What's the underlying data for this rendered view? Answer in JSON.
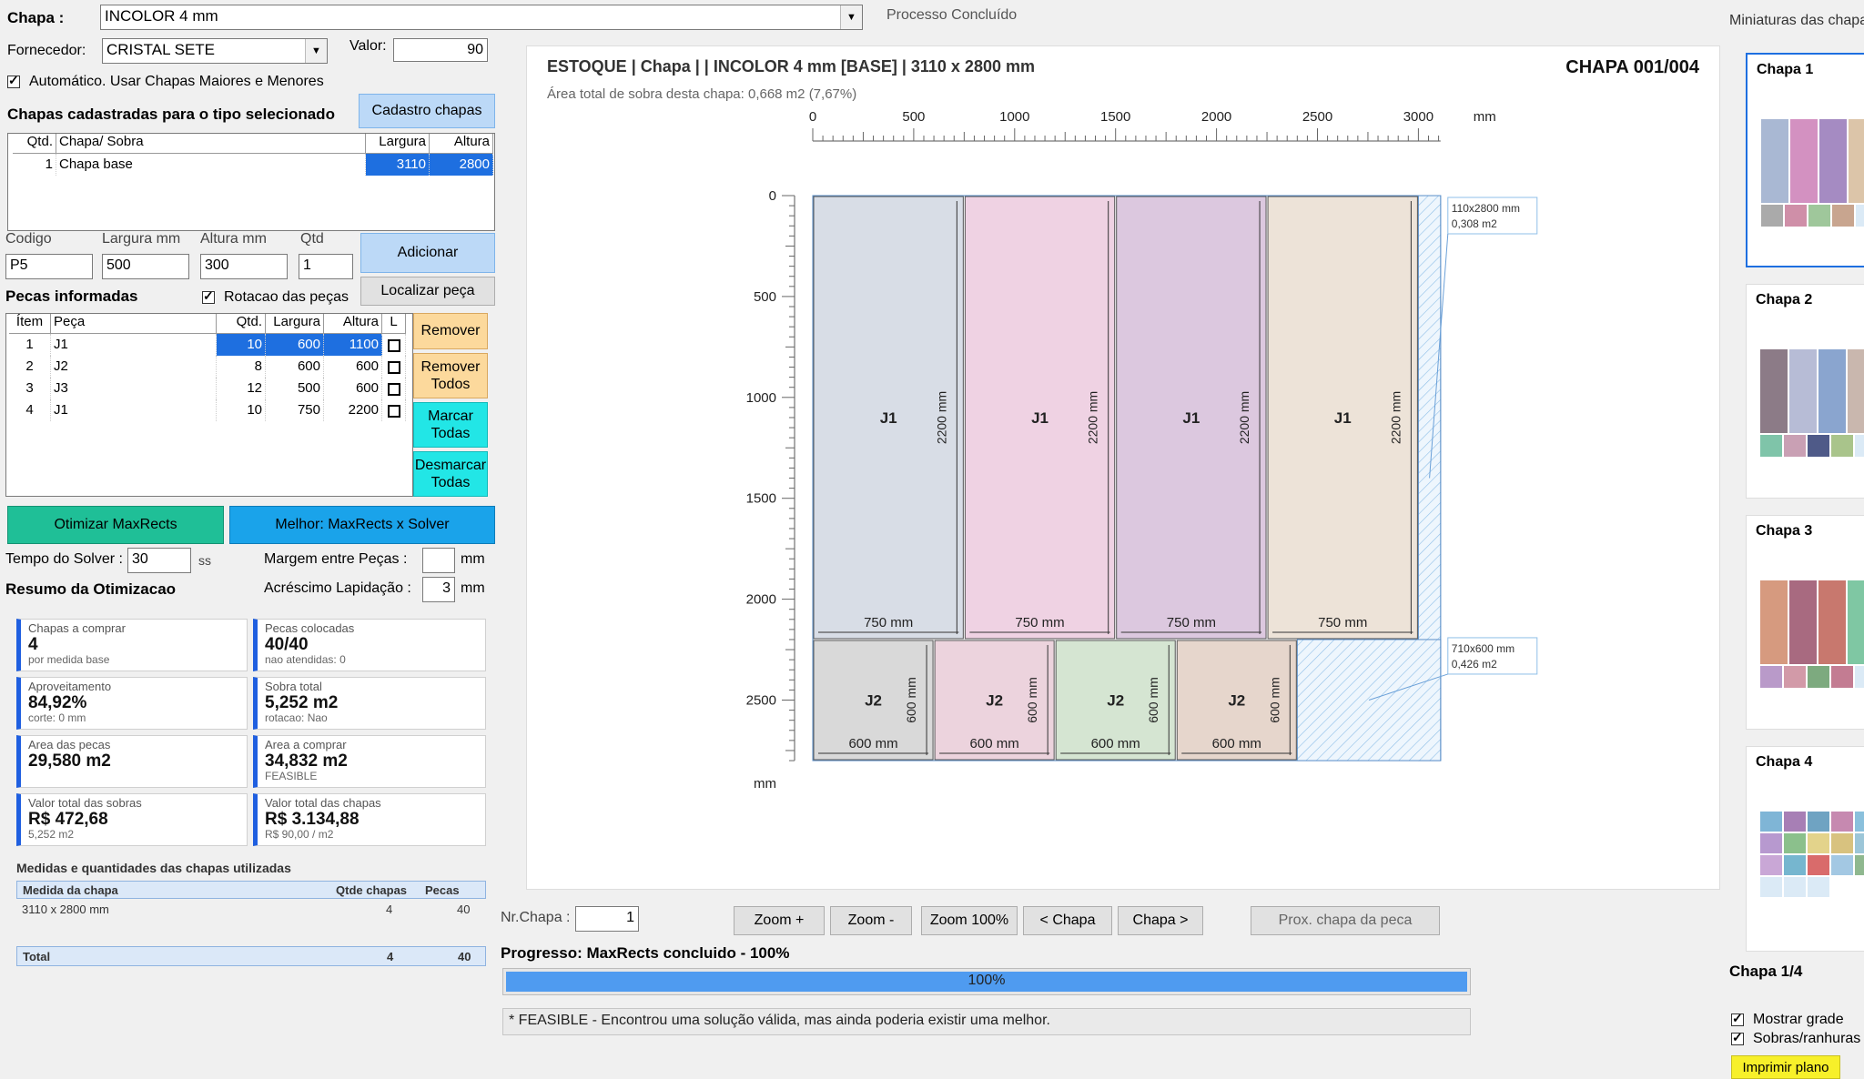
{
  "top": {
    "chapa_label": "Chapa :",
    "chapa_value": "INCOLOR 4 mm",
    "status": "Processo Concluído",
    "fornecedor_label": "Fornecedor:",
    "fornecedor_value": "CRISTAL SETE",
    "valor_label": "Valor:",
    "valor_value": "90",
    "auto_label": "Automático. Usar Chapas Maiores e Menores",
    "section_title": "Chapas cadastradas para o tipo selecionado",
    "cadastro_btn": "Cadastro chapas"
  },
  "chapas_grid": {
    "headers": [
      "Qtd.",
      "Chapa/ Sobra",
      "Largura",
      "Altura"
    ],
    "rows": [
      [
        "1",
        "Chapa base",
        "3110",
        "2800"
      ]
    ]
  },
  "add_form": {
    "codigo_label": "Codigo",
    "largura_label": "Largura mm",
    "altura_label": "Altura mm",
    "qtd_label": "Qtd",
    "codigo_value": "P5",
    "largura_value": "500",
    "altura_value": "300",
    "qtd_value": "1",
    "adicionar_btn": "Adicionar",
    "localizar_btn": "Localizar peça",
    "pecas_title": "Pecas informadas",
    "rotacao_label": "Rotacao das peças"
  },
  "pecas_grid": {
    "headers": [
      "Ítem",
      "Peça",
      "Qtd.",
      "Largura",
      "Altura",
      "L"
    ],
    "rows": [
      [
        "1",
        "J1",
        "10",
        "600",
        "1100"
      ],
      [
        "2",
        "J2",
        "8",
        "600",
        "600"
      ],
      [
        "3",
        "J3",
        "12",
        "500",
        "600"
      ],
      [
        "4",
        "J1",
        "10",
        "750",
        "2200"
      ]
    ]
  },
  "side_buttons": {
    "remover": "Remover",
    "remover_todos_1": "Remover",
    "remover_todos_2": "Todos",
    "marcar_1": "Marcar",
    "marcar_2": "Todas",
    "desmarcar_1": "Desmarcar",
    "desmarcar_2": "Todas"
  },
  "optimize": {
    "otimizar_btn": "Otimizar MaxRects",
    "melhor_btn": "Melhor: MaxRects x Solver",
    "tempo_label": "Tempo do Solver :",
    "tempo_value": "30",
    "tempo_unit": "ss",
    "margem_label": "Margem entre Peças :",
    "margem_value": "",
    "margem_unit": "mm",
    "resumo_title": "Resumo da Otimizacao",
    "acrescimo_label": "Acréscimo Lapidação :",
    "acrescimo_value": "3",
    "acrescimo_unit": "mm"
  },
  "cards": [
    {
      "t": "Chapas a comprar",
      "v": "4",
      "s": "por medida base"
    },
    {
      "t": "Pecas colocadas",
      "v": "40/40",
      "s": "nao atendidas: 0"
    },
    {
      "t": "Aproveitamento",
      "v": "84,92%",
      "s": "corte: 0 mm"
    },
    {
      "t": "Sobra total",
      "v": "5,252 m2",
      "s": "rotacao: Nao"
    },
    {
      "t": "Area das pecas",
      "v": "29,580 m2",
      "s": ""
    },
    {
      "t": "Area a comprar",
      "v": "34,832 m2",
      "s": "FEASIBLE"
    },
    {
      "t": "Valor total das sobras",
      "v": "R$ 472,68",
      "s": "5,252 m2"
    },
    {
      "t": "Valor total das chapas",
      "v": "R$ 3.134,88",
      "s": "R$ 90,00 / m2"
    }
  ],
  "medidas": {
    "title": "Medidas e quantidades das chapas utilizadas",
    "headers": [
      "Medida da chapa",
      "Qtde chapas",
      "Pecas"
    ],
    "row": [
      "3110 x 2800 mm",
      "4",
      "40"
    ],
    "total": [
      "Total",
      "4",
      "40"
    ]
  },
  "canvas": {
    "header_left": "ESTOQUE | Chapa | | INCOLOR 4 mm [BASE] | 3110 x 2800 mm",
    "header_right": "CHAPA 001/004",
    "subheader": "Área total de sobra desta chapa: 0,668 m2 (7,67%)",
    "unit_x": "mm",
    "unit_y": "mm",
    "sheet_w": 3110,
    "sheet_h": 2800,
    "x_ticks": [
      0,
      500,
      1000,
      1500,
      2000,
      2500,
      3000
    ],
    "y_ticks": [
      0,
      500,
      1000,
      1500,
      2000,
      2500
    ],
    "pieces": [
      {
        "x": 0,
        "y": 0,
        "w": 750,
        "h": 2200,
        "name": "J1",
        "wl": "750 mm",
        "hl": "2200 mm",
        "color": "#d8dde6"
      },
      {
        "x": 750,
        "y": 0,
        "w": 750,
        "h": 2200,
        "name": "J1",
        "wl": "750 mm",
        "hl": "2200 mm",
        "color": "#efd2e3"
      },
      {
        "x": 1500,
        "y": 0,
        "w": 750,
        "h": 2200,
        "name": "J1",
        "wl": "750 mm",
        "hl": "2200 mm",
        "color": "#dcc8df"
      },
      {
        "x": 2250,
        "y": 0,
        "w": 750,
        "h": 2200,
        "name": "J1",
        "wl": "750 mm",
        "hl": "2200 mm",
        "color": "#ede3d8"
      },
      {
        "x": 0,
        "y": 2200,
        "w": 600,
        "h": 600,
        "name": "J2",
        "wl": "600 mm",
        "hl": "600 mm",
        "color": "#d9d9d9"
      },
      {
        "x": 600,
        "y": 2200,
        "w": 600,
        "h": 600,
        "name": "J2",
        "wl": "600 mm",
        "hl": "600 mm",
        "color": "#ecd3dd"
      },
      {
        "x": 1200,
        "y": 2200,
        "w": 600,
        "h": 600,
        "name": "J2",
        "wl": "600 mm",
        "hl": "600 mm",
        "color": "#d5e5d2"
      },
      {
        "x": 1800,
        "y": 2200,
        "w": 600,
        "h": 600,
        "name": "J2",
        "wl": "600 mm",
        "hl": "600 mm",
        "color": "#e6d6cc"
      }
    ],
    "scraps": [
      {
        "x": 3000,
        "y": 0,
        "w": 110,
        "h": 2800,
        "l1": "110x2800 mm",
        "l2": "0,308 m2"
      },
      {
        "x": 2400,
        "y": 2200,
        "w": 710,
        "h": 600,
        "l1": "710x600 mm",
        "l2": "0,426 m2"
      }
    ]
  },
  "bottom": {
    "nr_label": "Nr.Chapa :",
    "nr_value": "1",
    "zoom_in": "Zoom +",
    "zoom_out": "Zoom -",
    "zoom_100": "Zoom 100%",
    "prev": "< Chapa",
    "next": "Chapa >",
    "prox": "Prox. chapa da peca",
    "progress_label": "Progresso: MaxRects concluido - 100%",
    "progress_value": 100,
    "progress_text": "100%",
    "feasible": "* FEASIBLE - Encontrou uma solução válida, mas ainda poderia existir uma melhor."
  },
  "thumbs": {
    "title": "Miniaturas das chapas",
    "items": [
      "Chapa 1",
      "Chapa 2",
      "Chapa 3",
      "Chapa 4"
    ],
    "counter": "Chapa 1/4",
    "mostrar": "Mostrar grade",
    "sobras": "Sobras/ranhuras",
    "imprimir": "Imprimir plano"
  }
}
